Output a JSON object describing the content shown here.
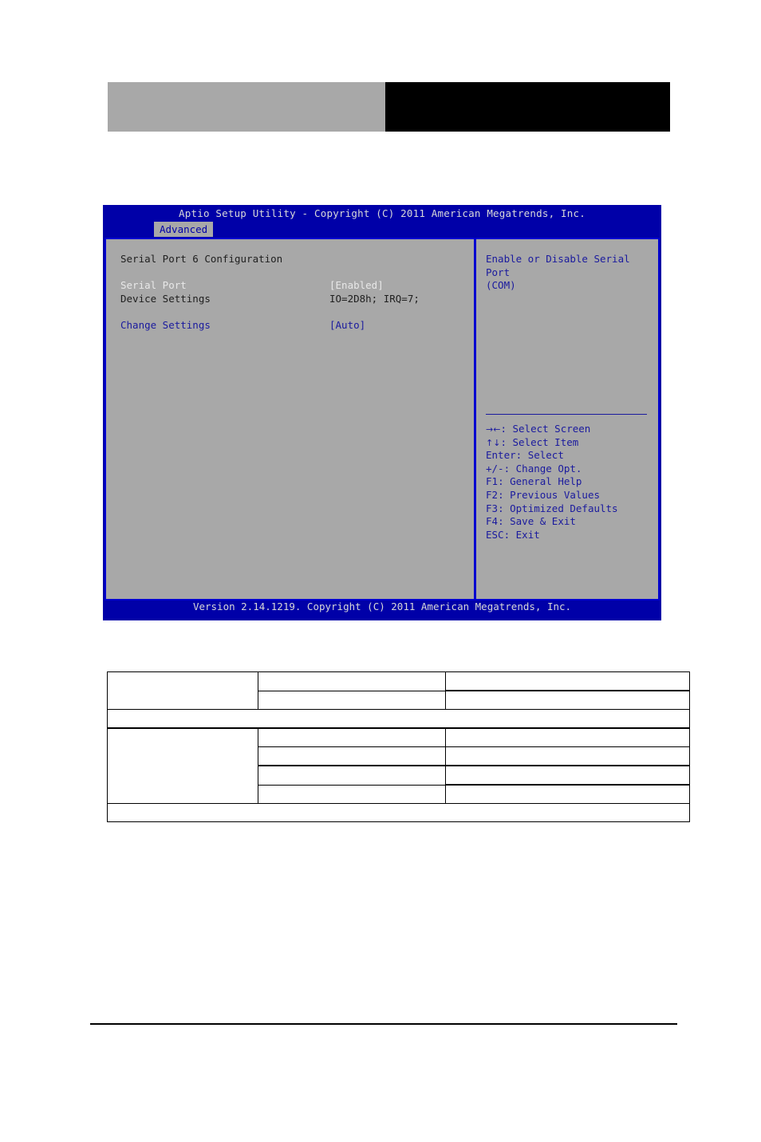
{
  "page": {
    "header_blocks": [
      {
        "name": "left-grey-block",
        "color": "#a8a8a8"
      },
      {
        "name": "right-black-block",
        "color": "#000000"
      }
    ]
  },
  "bios": {
    "title": "Aptio Setup Utility - Copyright (C) 2011 American Megatrends, Inc.",
    "menu_tabs": [
      {
        "label": "Advanced",
        "active": true
      }
    ],
    "section_title": "Serial Port 6 Configuration",
    "items": [
      {
        "label": "Serial Port",
        "value": "[Enabled]",
        "style": "highlight"
      },
      {
        "label": "Device Settings",
        "value": "IO=2D8h; IRQ=7;",
        "style": "normal"
      },
      {
        "label": "Change Settings",
        "value": "[Auto]",
        "style": "link"
      }
    ],
    "help_text": "Enable or Disable Serial Port\n(COM)",
    "key_legend": [
      {
        "keys": "→←",
        "sep": ": ",
        "action": "Select Screen"
      },
      {
        "keys": "↑↓",
        "sep": ": ",
        "action": "Select Item"
      },
      {
        "keys": "Enter",
        "sep": ": ",
        "action": "Select"
      },
      {
        "keys": "+/-",
        "sep": ": ",
        "action": "Change Opt."
      },
      {
        "keys": "F1",
        "sep": ": ",
        "action": "General Help"
      },
      {
        "keys": "F2",
        "sep": ": ",
        "action": "Previous Values"
      },
      {
        "keys": "F3",
        "sep": ": ",
        "action": "Optimized Defaults"
      },
      {
        "keys": "F4",
        "sep": ": ",
        "action": "Save & Exit"
      },
      {
        "keys": "ESC",
        "sep": ": ",
        "action": "Exit"
      }
    ],
    "footer": "Version 2.14.1219. Copyright (C) 2011 American Megatrends, Inc.",
    "colors": {
      "screen_blue": "#0000a8",
      "panel_grey": "#a8a8a8",
      "border_blue": "#0000d0",
      "text_blue": "#1a1a9e",
      "text_white": "#e8e8e8",
      "text_dark": "#202020"
    }
  },
  "spec_table": {
    "group_one": {
      "merged_cell": "",
      "rows": [
        {
          "col_b": "",
          "col_c": ""
        },
        {
          "col_b": "",
          "col_c": ""
        }
      ],
      "full_width_row": ""
    },
    "group_two": {
      "merged_cell": "",
      "rows": [
        {
          "col_b": "",
          "col_c": ""
        },
        {
          "col_b": "",
          "col_c": ""
        },
        {
          "col_b": "",
          "col_c": ""
        },
        {
          "col_b": "",
          "col_c": ""
        }
      ],
      "full_width_row": ""
    }
  }
}
